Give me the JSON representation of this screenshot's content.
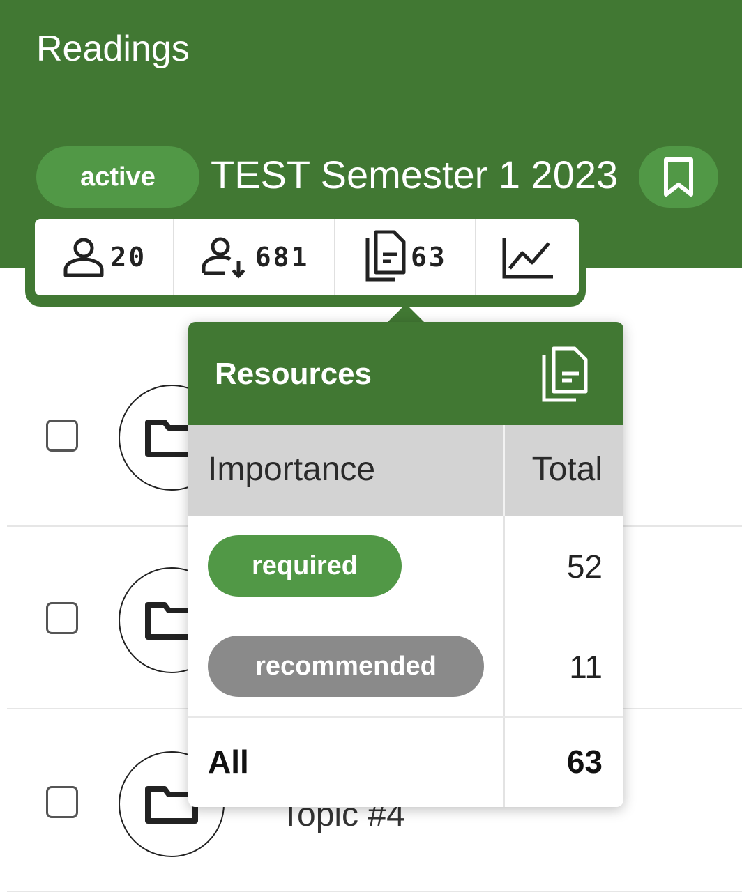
{
  "header": {
    "title": "Readings",
    "status_badge": "active",
    "course_title": "TEST Semester 1 2023"
  },
  "stats": [
    {
      "icon": "person-icon",
      "value": "20"
    },
    {
      "icon": "person-download-icon",
      "value": "681"
    },
    {
      "icon": "documents-icon",
      "value": "63"
    },
    {
      "icon": "line-chart-icon",
      "value": ""
    }
  ],
  "list": {
    "rows": [
      {
        "label": "",
        "icon": "folder-icon"
      },
      {
        "label": "",
        "icon": "folder-icon"
      },
      {
        "label": "Topic #4",
        "icon": "folder-icon"
      }
    ]
  },
  "popover": {
    "title": "Resources",
    "icon": "documents-icon",
    "columns": [
      "Importance",
      "Total"
    ],
    "rows": [
      {
        "importance": "required",
        "total": "52",
        "color": "#519846"
      },
      {
        "importance": "recommended",
        "total": "11",
        "color": "#8a8a8a"
      }
    ],
    "footer": {
      "label": "All",
      "total": "63"
    }
  },
  "colors": {
    "header": "#417833",
    "badge": "#519846"
  }
}
